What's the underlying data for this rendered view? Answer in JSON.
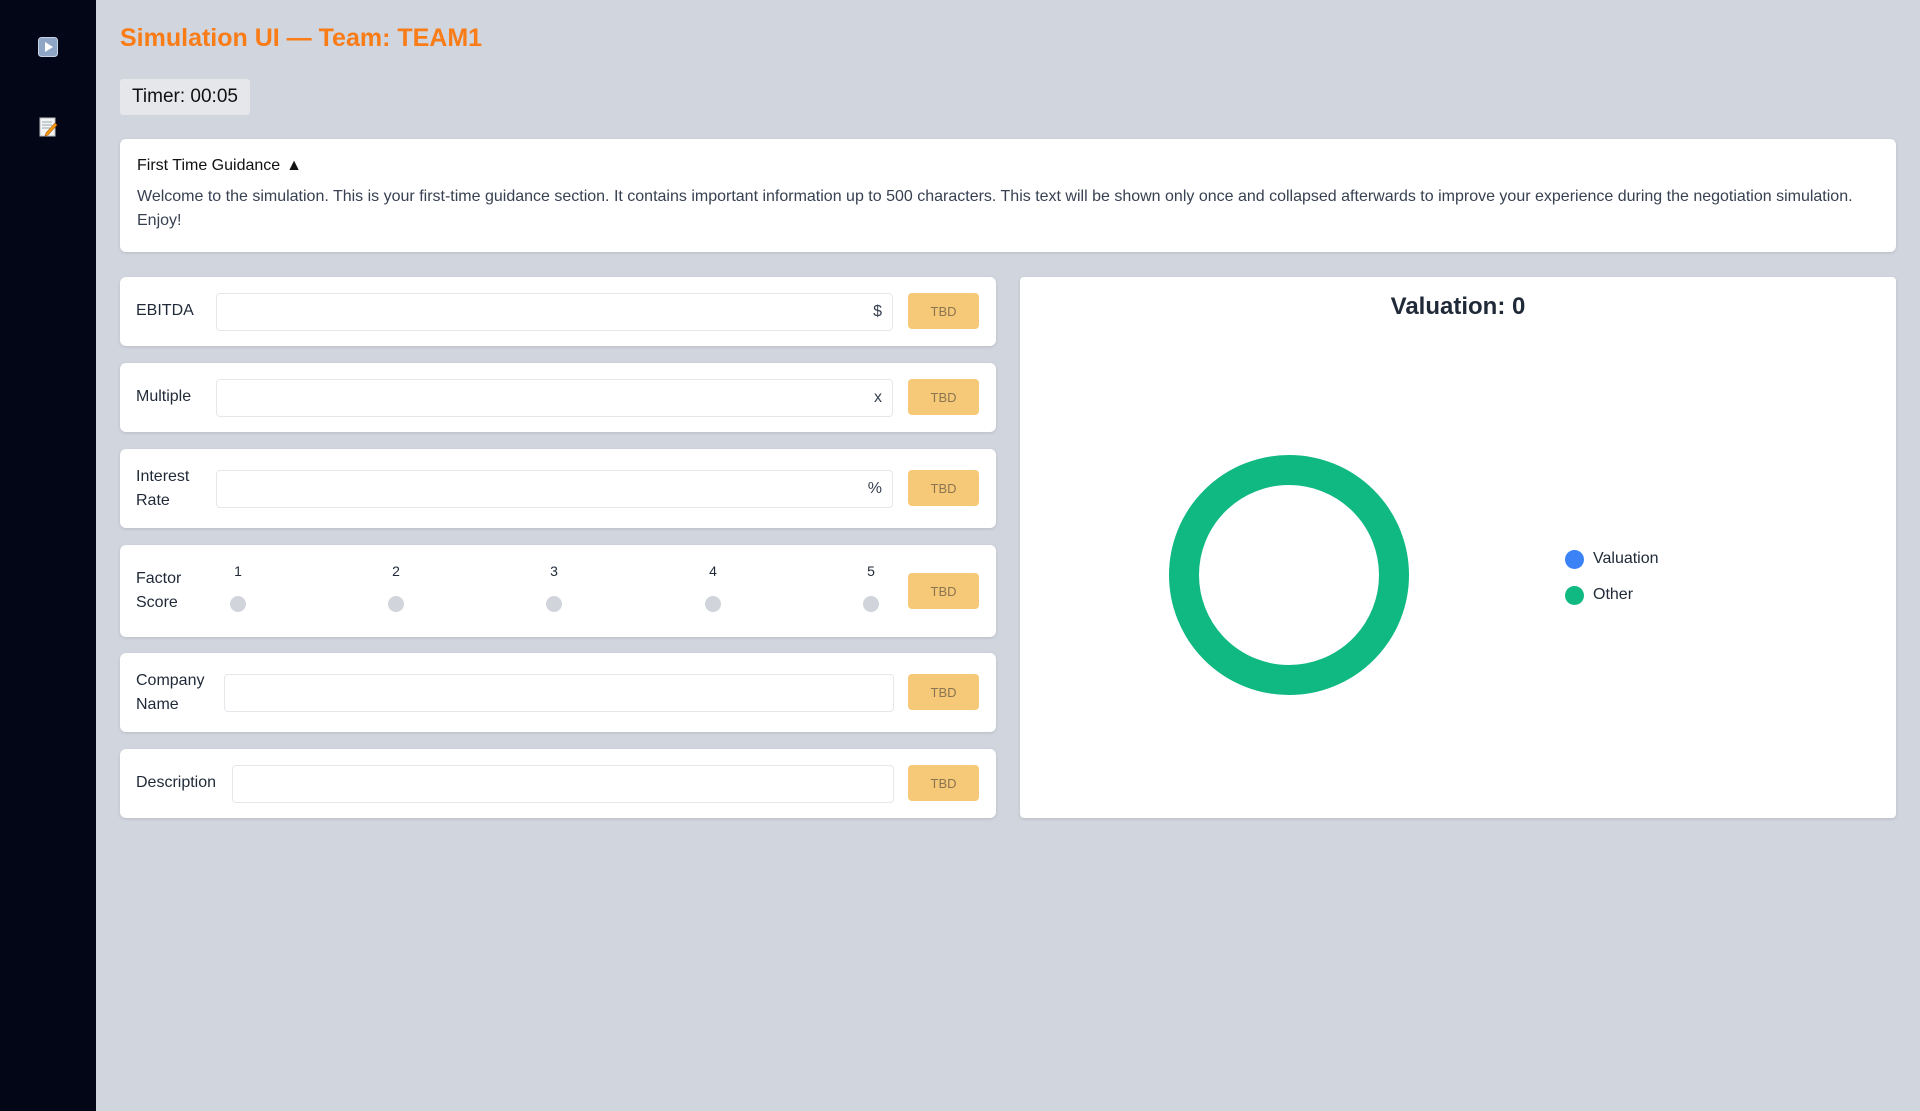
{
  "header": {
    "title": "Simulation UI — Team: TEAM1",
    "timer": "Timer: 00:05"
  },
  "sidebar": {
    "items": [
      {
        "icon": "play-icon"
      },
      {
        "icon": "notes-icon"
      }
    ]
  },
  "guidance": {
    "title": "First Time Guidance",
    "toggle": "▲",
    "text": "Welcome to the simulation. This is your first-time guidance section. It contains important information up to 500 characters. This text will be shown only once and collapsed afterwards to improve your experience during the negotiation simulation. Enjoy!"
  },
  "fields": {
    "ebitda": {
      "label": "EBITDA",
      "value": "",
      "unit": "$",
      "button": "TBD"
    },
    "multiple": {
      "label": "Multiple",
      "value": "",
      "unit": "x",
      "button": "TBD"
    },
    "interest_rate": {
      "label_line1": "Interest",
      "label_line2": "Rate",
      "value": "",
      "unit": "%",
      "button": "TBD"
    },
    "factor_score": {
      "label_line1": "Factor",
      "label_line2": "Score",
      "options": [
        "1",
        "2",
        "3",
        "4",
        "5"
      ],
      "selected": null,
      "button": "TBD"
    },
    "company_name": {
      "label_line1": "Company",
      "label_line2": "Name",
      "value": "",
      "button": "TBD"
    },
    "description": {
      "label": "Description",
      "value": "",
      "button": "TBD"
    }
  },
  "chart": {
    "title": "Valuation: 0",
    "legend": [
      {
        "name": "Valuation",
        "color": "#3b82f6"
      },
      {
        "name": "Other",
        "color": "#10b981"
      }
    ]
  },
  "chart_data": {
    "type": "pie",
    "title": "Valuation: 0",
    "categories": [
      "Valuation",
      "Other"
    ],
    "values": [
      0,
      1
    ],
    "colors": [
      "#3b82f6",
      "#10b981"
    ],
    "donut": true,
    "legend_position": "right"
  }
}
